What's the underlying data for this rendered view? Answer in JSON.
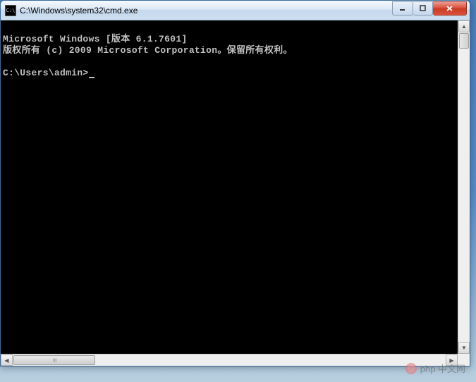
{
  "window": {
    "title": "C:\\Windows\\system32\\cmd.exe",
    "icon_label": "C:\\"
  },
  "console": {
    "line1": "Microsoft Windows [版本 6.1.7601]",
    "line2": "版权所有 (c) 2009 Microsoft Corporation。保留所有权利。",
    "prompt": "C:\\Users\\admin>"
  },
  "watermark": {
    "text": "php 中文网"
  }
}
